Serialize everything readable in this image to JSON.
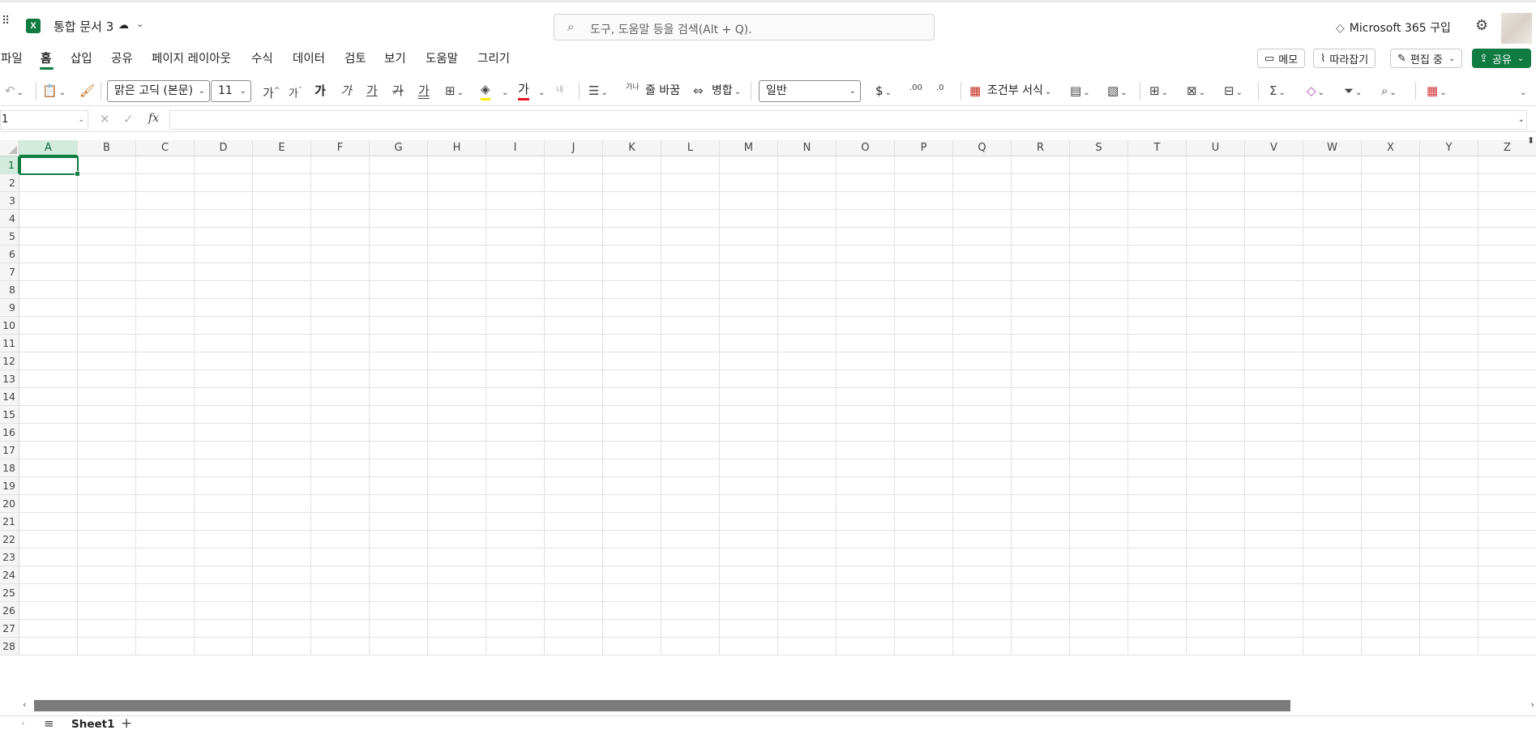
{
  "titlebar": {
    "app_logo": "X",
    "doc_title": "통합 문서 3",
    "search_placeholder": "도구, 도움말 등을 검색(Alt + Q).",
    "buy_label": "Microsoft 365 구입",
    "icons": [
      "waffle-icon",
      "excel-logo",
      "cloud-sync-icon",
      "chevron-down-icon",
      "search-icon",
      "diamond-icon",
      "gear-icon",
      "avatar"
    ]
  },
  "tabs": [
    {
      "label": "파일"
    },
    {
      "label": "홈"
    },
    {
      "label": "삽입"
    },
    {
      "label": "공유"
    },
    {
      "label": "페이지 레이아웃"
    },
    {
      "label": "수식"
    },
    {
      "label": "데이터"
    },
    {
      "label": "검토"
    },
    {
      "label": "보기"
    },
    {
      "label": "도움말"
    },
    {
      "label": "그리기"
    }
  ],
  "active_tab": "홈",
  "ribbon_right": {
    "comments": "메모",
    "catchup": "따라잡기",
    "editing": "편집 중",
    "share": "공유"
  },
  "toolbar": {
    "font_name": "맑은 고딕 (본문)",
    "font_size": "11",
    "wrap_text": "줄 바꿈",
    "merge": "병합",
    "number_format": "일반",
    "conditional_format": "조건부 서식",
    "glyph_increase_font": "가",
    "glyph_decrease_font": "가",
    "glyph_bold": "가",
    "glyph_italic": "가",
    "glyph_underline": "가",
    "glyph_double_underline": "가",
    "glyph_strike": "가",
    "glyph_font_color": "가",
    "glyph_text_dir": "내",
    "glyph_wrap": "가나",
    "currency": "$",
    "inc_decimal": ".00",
    "dec_decimal": ".0",
    "accent_color": "#107c41",
    "highlight_color": "#ffe500",
    "font_color": "#e81123"
  },
  "formula_bar": {
    "name_box": "1",
    "fx": "fx",
    "formula": ""
  },
  "grid": {
    "columns": [
      "A",
      "B",
      "C",
      "D",
      "E",
      "F",
      "G",
      "H",
      "I",
      "J",
      "K",
      "L",
      "M",
      "N",
      "O",
      "P",
      "Q",
      "R",
      "S",
      "T",
      "U",
      "V",
      "W",
      "X",
      "Y",
      "Z"
    ],
    "rows": [
      "1",
      "2",
      "3",
      "4",
      "5",
      "6",
      "7",
      "8",
      "9",
      "10",
      "11",
      "12",
      "13",
      "14",
      "15",
      "16",
      "17",
      "18",
      "19",
      "20",
      "21",
      "22",
      "23",
      "24",
      "25",
      "26",
      "27",
      "28"
    ],
    "selected_column": "A",
    "selected_row": "1"
  },
  "sheets": [
    {
      "label": "Sheet1",
      "active": true
    }
  ]
}
